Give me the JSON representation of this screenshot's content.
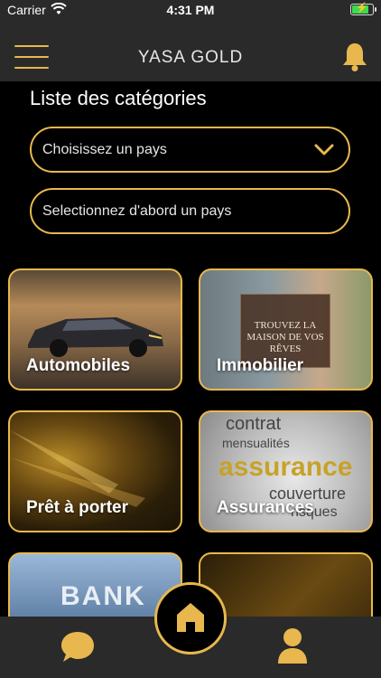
{
  "status_bar": {
    "carrier": "Carrier",
    "time": "4:31 PM"
  },
  "header": {
    "title": "YASA GOLD"
  },
  "section_title": "Liste des catégories",
  "country_select": {
    "placeholder": "Choisissez un pays"
  },
  "secondary_select": {
    "placeholder": "Selectionnez d'abord un pays"
  },
  "categories": [
    {
      "label": "Automobiles"
    },
    {
      "label": "Immobilier"
    },
    {
      "label": "Prêt à porter"
    },
    {
      "label": "Assurances"
    }
  ],
  "immo_sign_text": "TROUVEZ LA MAISON DE VOS RÊVES",
  "assurance_words": [
    "contrat",
    "mensualités",
    "assurance",
    "couverture",
    "risques"
  ],
  "bank_text": "BANK",
  "colors": {
    "accent": "#e8b84e",
    "background": "#000000",
    "bar": "#2a2a2a"
  },
  "icons": [
    "wifi-icon",
    "battery-icon",
    "menu-icon",
    "bell-icon",
    "chevron-down-icon",
    "chat-icon",
    "home-icon",
    "profile-icon"
  ]
}
